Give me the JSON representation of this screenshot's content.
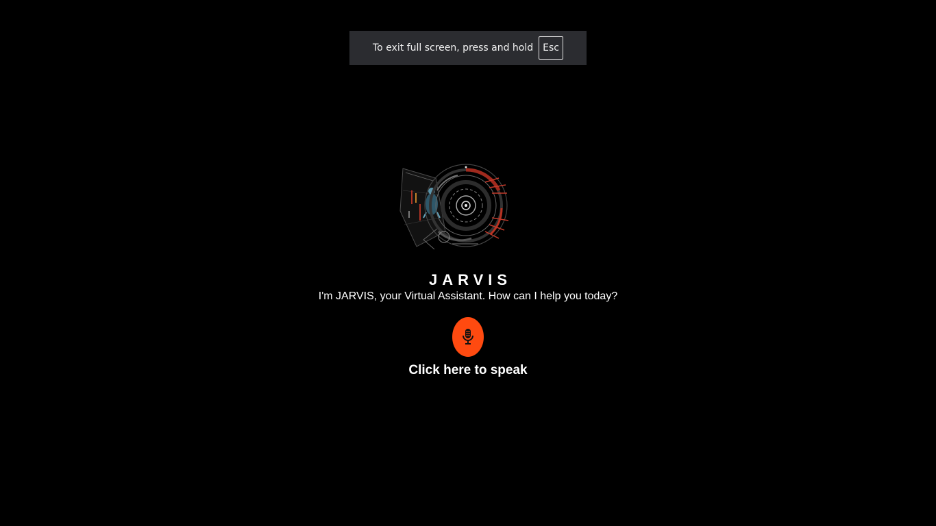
{
  "fullscreen_banner": {
    "message": "To exit full screen, press and hold",
    "key": "Esc"
  },
  "assistant": {
    "name": "JARVIS",
    "greeting": "I'm JARVIS, your Virtual Assistant. How can I help you today?",
    "speak_label": "Click here to speak",
    "mic_icon": "microphone-icon",
    "hud_image": "jarvis-hud-graphic"
  },
  "colors": {
    "background": "#000000",
    "accent": "#ff4a10",
    "banner": "#2b2c30"
  }
}
